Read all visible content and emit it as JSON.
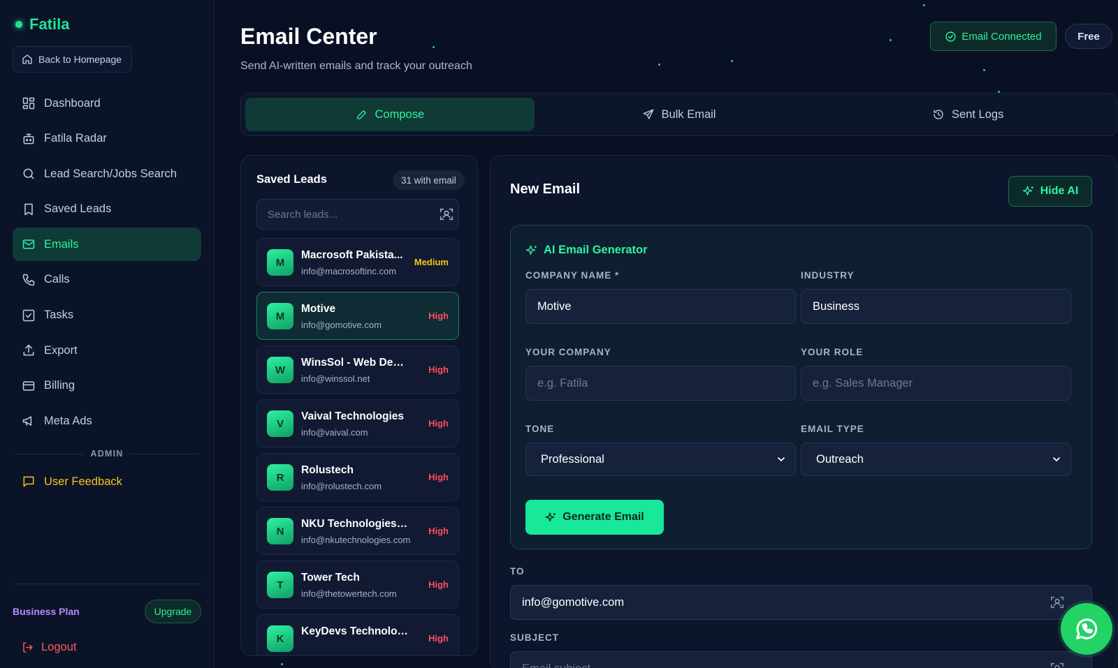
{
  "brand": {
    "name": "Fatila"
  },
  "sidebar": {
    "back_label": "Back to Homepage",
    "items": [
      {
        "label": "Dashboard",
        "icon": "dashboard-icon"
      },
      {
        "label": "Fatila Radar",
        "icon": "radar-icon"
      },
      {
        "label": "Lead Search/Jobs Search",
        "icon": "search-icon"
      },
      {
        "label": "Saved Leads",
        "icon": "bookmark-icon"
      },
      {
        "label": "Emails",
        "icon": "mail-icon",
        "active": true
      },
      {
        "label": "Calls",
        "icon": "phone-icon"
      },
      {
        "label": "Tasks",
        "icon": "checkbox-icon"
      },
      {
        "label": "Export",
        "icon": "upload-icon"
      },
      {
        "label": "Billing",
        "icon": "card-icon"
      },
      {
        "label": "Meta Ads",
        "icon": "megaphone-icon"
      }
    ],
    "admin_label": "ADMIN",
    "feedback_label": "User Feedback",
    "plan_label": "Business Plan",
    "upgrade_label": "Upgrade",
    "logout_label": "Logout"
  },
  "header": {
    "title": "Email Center",
    "subtitle": "Send AI-written emails and track your outreach",
    "connected_label": "Email Connected",
    "plan_badge": "Free"
  },
  "tabs": [
    {
      "label": "Compose",
      "active": true
    },
    {
      "label": "Bulk Email"
    },
    {
      "label": "Sent Logs"
    }
  ],
  "leads": {
    "title": "Saved Leads",
    "count_label": "31 with email",
    "search_placeholder": "Search leads...",
    "items": [
      {
        "initial": "M",
        "name": "Macrosoft Pakista...",
        "email": "info@macrosoftinc.com",
        "priority": "Medium"
      },
      {
        "initial": "M",
        "name": "Motive",
        "email": "info@gomotive.com",
        "priority": "High",
        "selected": true
      },
      {
        "initial": "W",
        "name": "WinsSol - Web Devel...",
        "email": "info@winssol.net",
        "priority": "High"
      },
      {
        "initial": "V",
        "name": "Vaival Technologies",
        "email": "info@vaival.com",
        "priority": "High"
      },
      {
        "initial": "R",
        "name": "Rolustech",
        "email": "info@rolustech.com",
        "priority": "High"
      },
      {
        "initial": "N",
        "name": "NKU Technologies (P...",
        "email": "info@nkutechnologies.com",
        "priority": "High"
      },
      {
        "initial": "T",
        "name": "Tower Tech",
        "email": "info@thetowertech.com",
        "priority": "High"
      },
      {
        "initial": "K",
        "name": "KeyDevs Technologi...",
        "email": "",
        "priority": "High"
      }
    ]
  },
  "email": {
    "title": "New Email",
    "hide_ai_label": "Hide AI",
    "ai": {
      "title": "AI Email Generator",
      "company_label": "COMPANY NAME *",
      "company_value": "Motive",
      "industry_label": "INDUSTRY",
      "industry_value": "Business",
      "your_company_label": "YOUR COMPANY",
      "your_company_placeholder": "e.g. Fatila",
      "your_role_label": "YOUR ROLE",
      "your_role_placeholder": "e.g. Sales Manager",
      "tone_label": "TONE",
      "tone_value": "Professional",
      "type_label": "EMAIL TYPE",
      "type_value": "Outreach",
      "generate_label": "Generate Email"
    },
    "to_label": "TO",
    "to_value": "info@gomotive.com",
    "subject_label": "SUBJECT",
    "subject_placeholder": "Email subject"
  },
  "colors": {
    "accent": "#2ef2a2",
    "background": "#0a1024",
    "priority_high": "#ff4d5e",
    "priority_medium": "#f5c518",
    "whatsapp": "#23d366"
  }
}
